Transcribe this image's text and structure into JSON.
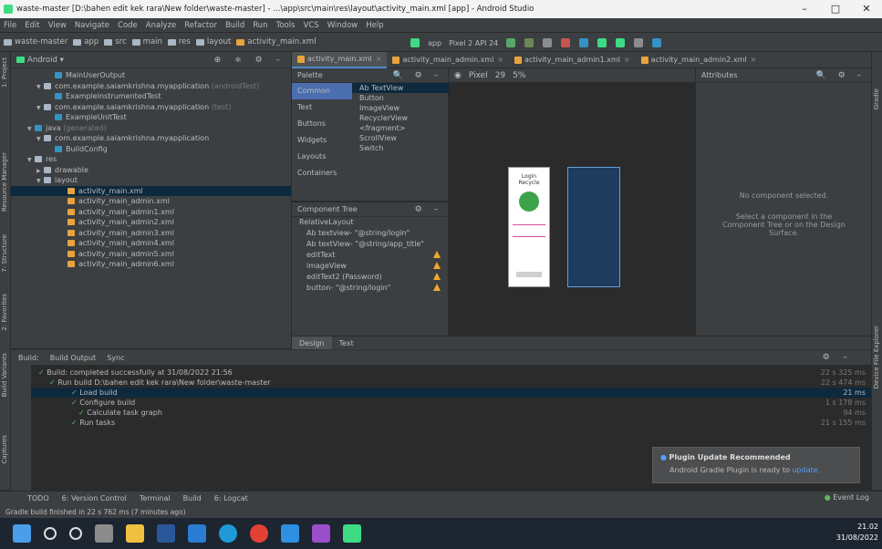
{
  "window": {
    "title": "waste-master [D:\\bahen edit kek rara\\New folder\\waste-master] - ...\\app\\src\\main\\res\\layout\\activity_main.xml [app] - Android Studio",
    "controls": [
      "–",
      "□",
      "✕"
    ]
  },
  "menu": [
    "File",
    "Edit",
    "View",
    "Navigate",
    "Code",
    "Analyze",
    "Refactor",
    "Build",
    "Run",
    "Tools",
    "VCS",
    "Window",
    "Help"
  ],
  "breadcrumbs": [
    "waste-master",
    "app",
    "src",
    "main",
    "res",
    "layout",
    "activity_main.xml"
  ],
  "toolbar": {
    "run_config": "app",
    "device": "Pixel 2 API 24"
  },
  "project_panel": {
    "view_mode": "Android",
    "items": [
      {
        "label": "MainUserOutput",
        "suffix": ""
      },
      {
        "label": "com.example.saiamkrishna.myapplication",
        "suffix": "(androidTest)"
      },
      {
        "label": "ExampleInstrumentedTest",
        "suffix": ""
      },
      {
        "label": "com.example.saiamkrishna.myapplication",
        "suffix": "(test)"
      },
      {
        "label": "ExampleUnitTest",
        "suffix": ""
      },
      {
        "label": "java",
        "suffix": "(generated)"
      },
      {
        "label": "com.example.saiamkrishna.myapplication",
        "suffix": ""
      },
      {
        "label": "BuildConfig",
        "suffix": ""
      },
      {
        "label": "res",
        "suffix": ""
      },
      {
        "label": "drawable",
        "suffix": ""
      },
      {
        "label": "layout",
        "suffix": ""
      },
      {
        "label": "activity_main.xml",
        "suffix": ""
      },
      {
        "label": "activity_main_admin.xml",
        "suffix": ""
      },
      {
        "label": "activity_main_admin1.xml",
        "suffix": ""
      },
      {
        "label": "activity_main_admin2.xml",
        "suffix": ""
      },
      {
        "label": "activity_main_admin3.xml",
        "suffix": ""
      },
      {
        "label": "activity_main_admin4.xml",
        "suffix": ""
      },
      {
        "label": "activity_main_admin5.xml",
        "suffix": ""
      },
      {
        "label": "activity_main_admin6.xml",
        "suffix": ""
      }
    ]
  },
  "editor_tabs": [
    "activity_main.xml",
    "activity_main_admin.xml",
    "activity_main_admin1.xml",
    "activity_main_admin2.xml"
  ],
  "palette": {
    "title": "Palette",
    "categories": [
      "Common",
      "Text",
      "Buttons",
      "Widgets",
      "Layouts",
      "Containers"
    ],
    "items": [
      "Ab TextView",
      "Button",
      "ImageView",
      "RecyclerView",
      "<fragment>",
      "ScrollView",
      "Switch"
    ]
  },
  "component_tree": {
    "title": "Component Tree",
    "rows": [
      {
        "label": "RelativeLayout",
        "warn": false
      },
      {
        "label": "Ab textview- \"@string/login\"",
        "warn": false
      },
      {
        "label": "Ab textView- \"@string/app_title\"",
        "warn": false
      },
      {
        "label": "editText",
        "warn": true
      },
      {
        "label": "imageView",
        "warn": true
      },
      {
        "label": "editText2 (Password)",
        "warn": true
      },
      {
        "label": "button- \"@string/login\"",
        "warn": true
      }
    ]
  },
  "design_tabs": [
    "Design",
    "Text"
  ],
  "canvas_toolbar": {
    "device": "Pixel",
    "api": "29",
    "zoom": "5%"
  },
  "attributes": {
    "title": "Attributes",
    "empty_title": "No component selected.",
    "empty_hint": "Select a component in the Component Tree or on the Design Surface."
  },
  "phone_preview": {
    "title": "Login",
    "subtitle": "Recycle"
  },
  "build": {
    "tabs": [
      "Build:",
      "Build Output",
      "Sync"
    ],
    "rows": [
      {
        "text": "Build: completed successfully at 31/08/2022 21:56",
        "time": "22 s 325 ms",
        "indent": 0,
        "selected": false
      },
      {
        "text": "Run build D:\\bahen edit kek rara\\New folder\\waste-master",
        "time": "22 s 474 ms",
        "indent": 1,
        "selected": false
      },
      {
        "text": "Load build",
        "time": "21 ms",
        "indent": 2,
        "selected": true
      },
      {
        "text": "Configure build",
        "time": "1 s 178 ms",
        "indent": 2,
        "selected": false
      },
      {
        "text": "Calculate task graph",
        "time": "94 ms",
        "indent": 2,
        "selected": false
      },
      {
        "text": "Run tasks",
        "time": "21 s 155 ms",
        "indent": 2,
        "selected": false
      }
    ]
  },
  "notification": {
    "title": "Plugin Update Recommended",
    "body": "Android Gradle Plugin is ready to",
    "link": "update."
  },
  "bottom_tabs": [
    "TODO",
    "6: Version Control",
    "Terminal",
    "Build",
    "6: Logcat"
  ],
  "event_log": "Event Log",
  "status": "Gradle build finished in 22 s 762 ms (7 minutes ago)",
  "left_tool_labels": [
    "1: Project",
    "Resource Manager",
    "7: Structure",
    "2: Favorites",
    "Build Variants",
    "Captures"
  ],
  "right_tool_labels": [
    "Gradle",
    "Device File Explorer"
  ],
  "clock": {
    "time": "21.02",
    "date": "31/08/2022"
  }
}
